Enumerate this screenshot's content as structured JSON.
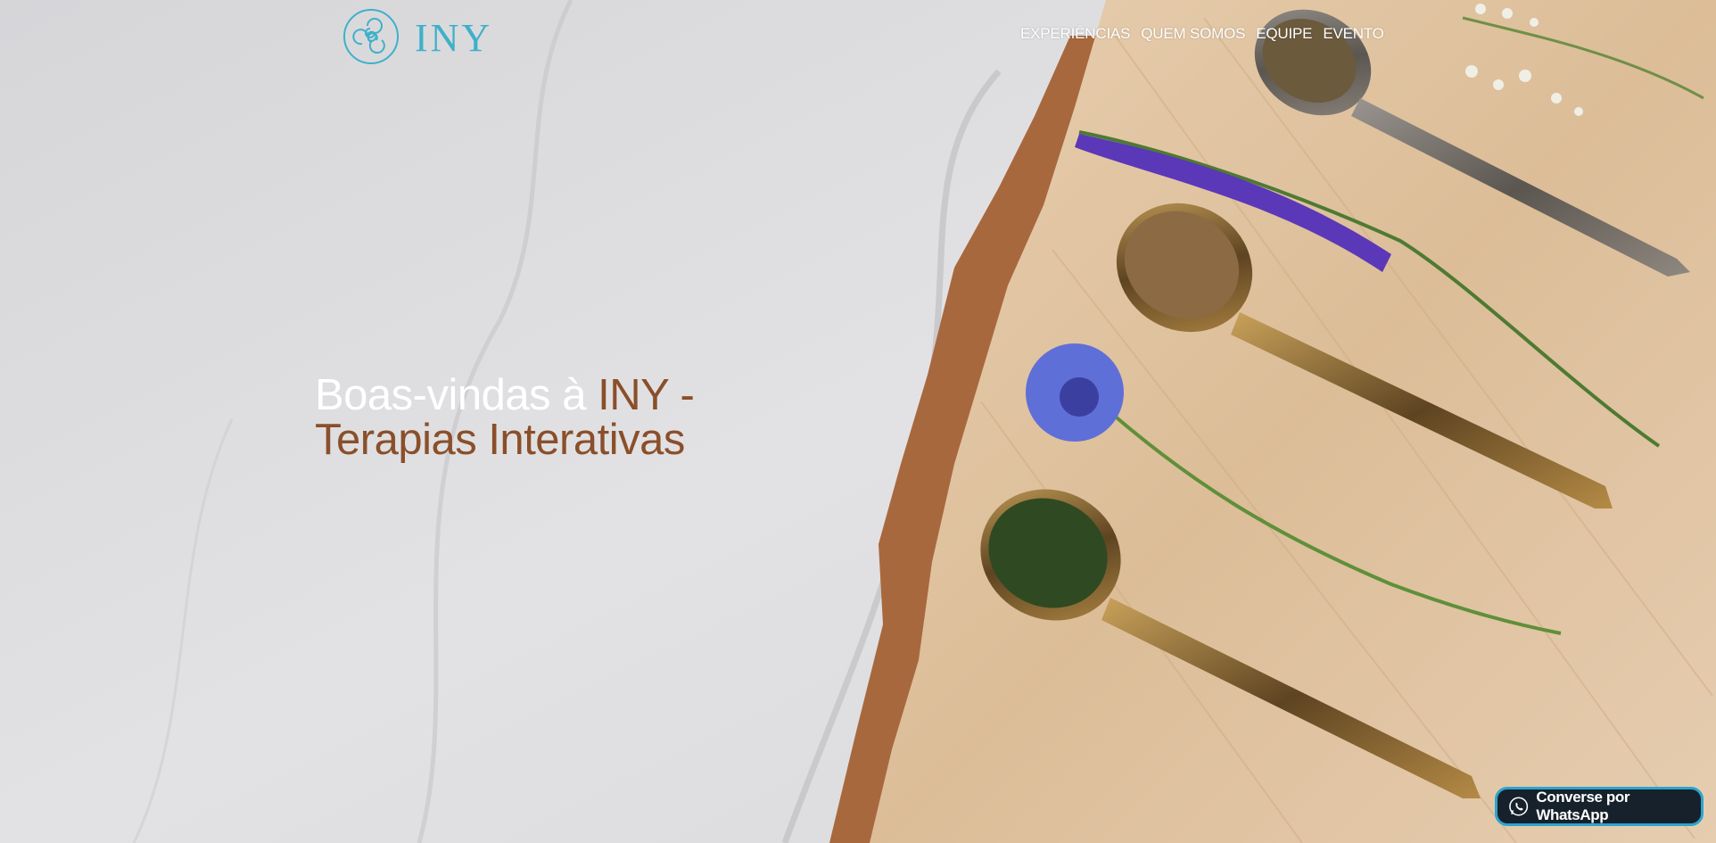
{
  "brand": {
    "logo_text": "INY",
    "color": "#3fb0c9"
  },
  "nav": {
    "items": [
      {
        "label": "EXPERIÊNCIAS"
      },
      {
        "label": "QUEM SOMOS"
      },
      {
        "label": "EQUIPE"
      },
      {
        "label": "EVENTO"
      }
    ]
  },
  "hero": {
    "heading_white": "Boas-vindas à",
    "heading_brown_1": "INY -",
    "heading_brown_2": "Terapias Interativas",
    "heading_color_white": "#ffffff",
    "heading_color_brown": "#8a4f2a"
  },
  "whatsapp": {
    "label": "Converse por WhatsApp",
    "icon": "whatsapp-icon"
  }
}
